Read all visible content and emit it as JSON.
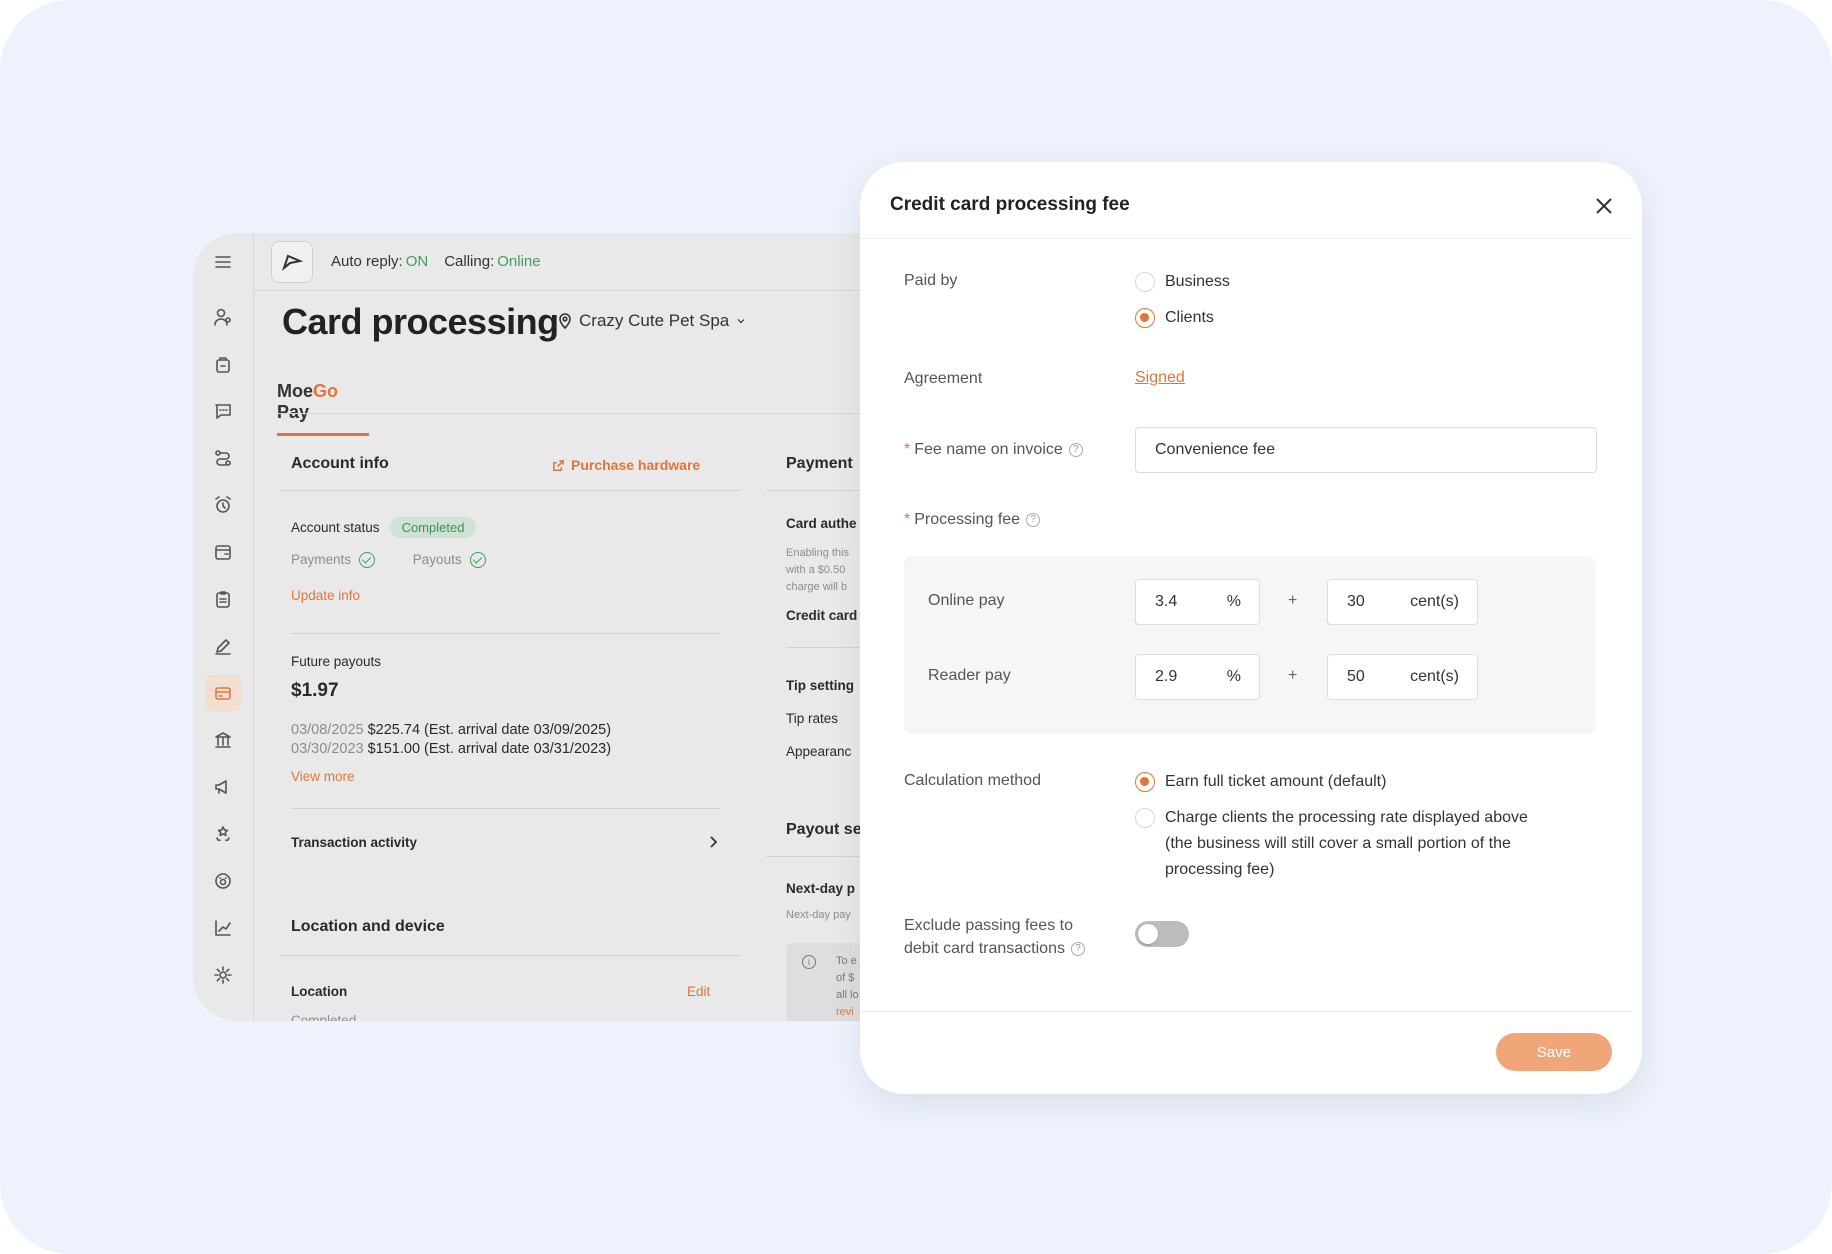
{
  "app": {
    "topbar": {
      "auto_reply_label": "Auto reply:",
      "auto_reply_value": "ON",
      "calling_label": "Calling:",
      "calling_value": "Online"
    },
    "page_title": "Card processing",
    "business_name": "Crazy Cute Pet Spa",
    "tab": {
      "brand_prefix": "Moe",
      "brand_go": "Go",
      "brand_suffix": "Pay"
    },
    "account_info": {
      "title": "Account info",
      "purchase_hardware": "Purchase hardware",
      "account_status_label": "Account status",
      "account_status_badge": "Completed",
      "payments_label": "Payments",
      "payouts_label": "Payouts",
      "update_info": "Update info",
      "future_payouts_label": "Future payouts",
      "future_payouts_amount": "$1.97",
      "payouts": [
        {
          "date": "03/08/2025",
          "detail": "$225.74 (Est. arrival date 03/09/2025)"
        },
        {
          "date": "03/30/2023",
          "detail": "$151.00 (Est. arrival date 03/31/2023)"
        }
      ],
      "view_more": "View more",
      "transaction_activity": "Transaction activity"
    },
    "location_device": {
      "title": "Location and device",
      "location_label": "Location",
      "edit": "Edit",
      "location_status": "Completed"
    },
    "right_column": {
      "payment_title": "Payment",
      "card_auth": "Card authe",
      "card_auth_desc": [
        "Enabling this",
        "with a $0.50",
        "charge will b"
      ],
      "credit_card": "Credit card",
      "tip_setting": "Tip setting",
      "tip_rates": "Tip rates",
      "appearance": "Appearanc",
      "payout_title": "Payout se",
      "next_day": "Next-day p",
      "next_day_desc": "Next-day pay",
      "notice_lines": [
        "To e",
        "of $",
        "all lo",
        "revi"
      ]
    }
  },
  "modal": {
    "title": "Credit card processing fee",
    "paid_by_label": "Paid by",
    "paid_by_options": [
      "Business",
      "Clients"
    ],
    "paid_by_selected": "Clients",
    "agreement_label": "Agreement",
    "agreement_value": "Signed",
    "fee_name_label": "Fee name on invoice",
    "fee_name_value": "Convenience fee",
    "processing_fee_label": "Processing fee",
    "online_pay": {
      "label": "Online pay",
      "percent": "3.4",
      "percent_unit": "%",
      "cents": "30",
      "cents_unit": "cent(s)"
    },
    "reader_pay": {
      "label": "Reader pay",
      "percent": "2.9",
      "percent_unit": "%",
      "cents": "50",
      "cents_unit": "cent(s)"
    },
    "plus": "+",
    "calc_method_label": "Calculation method",
    "calc_options": [
      "Earn full ticket amount (default)",
      "Charge clients the processing rate displayed above",
      "(the business will still cover a small portion of the",
      "processing fee)"
    ],
    "calc_selected": "Earn full ticket amount (default)",
    "exclude_label_line1": "Exclude passing fees to",
    "exclude_label_line2": "debit card transactions",
    "exclude_toggle": "off",
    "save": "Save",
    "help_glyph": "?"
  },
  "colors": {
    "background": "#edf2fc",
    "accent": "#e0753b",
    "success": "#3e9e5a",
    "save_button": "#f1a67a"
  }
}
